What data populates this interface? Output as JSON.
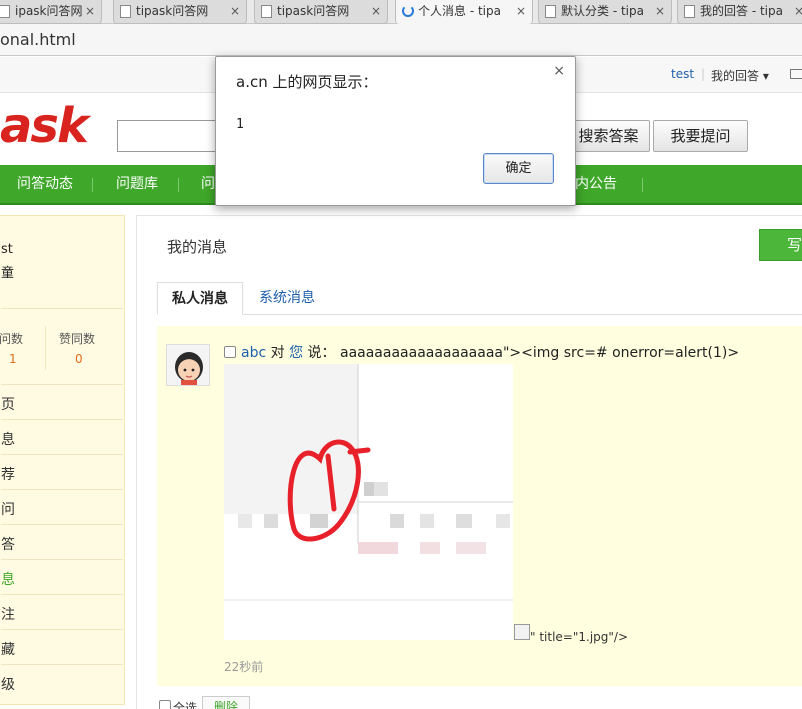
{
  "browser": {
    "tabs": [
      {
        "label": "ipask问答网",
        "close": "×"
      },
      {
        "label": "tipask问答网",
        "close": "×"
      },
      {
        "label": "tipask问答网",
        "close": "×"
      },
      {
        "label": "个人消息 - tipa",
        "close": "×"
      },
      {
        "label": "默认分类 - tipa",
        "close": "×"
      },
      {
        "label": "我的回答 - tipa",
        "close": "×"
      }
    ],
    "address": "onal.html"
  },
  "topbar": {
    "user": "test",
    "separator": "|",
    "my_answers": "我的回答 ▾"
  },
  "header": {
    "logo": "ask",
    "search_answers_button": "搜索答案",
    "ask_question_button": "我要提问"
  },
  "nav": {
    "items": [
      "问答动态",
      "问题库",
      "问",
      "站内公告"
    ]
  },
  "sidebar": {
    "name": "st",
    "subtitle": "童",
    "stats": [
      {
        "label": "提问数",
        "value": "1"
      },
      {
        "label": "赞同数",
        "value": "0"
      }
    ],
    "menu": [
      "页",
      "息",
      "荐",
      "问",
      "答",
      "息",
      "注",
      "藏",
      "级"
    ],
    "active_index": 5
  },
  "main": {
    "title": "我的消息",
    "write_button": "写",
    "tabs": [
      {
        "label": "私人消息",
        "active": true
      },
      {
        "label": "系统消息",
        "active": false
      }
    ],
    "message": {
      "sender": "abc",
      "to": "对",
      "you": "您",
      "says": "说：",
      "content": "aaaaaaaaaaaaaaaaaaa\"><img src=# onerror=alert(1)>",
      "trailing_text": "\" title=\"1.jpg\"/>",
      "time": "22秒前"
    },
    "select_all_label": "全选",
    "delete_button": "删除"
  },
  "dialog": {
    "title": "a.cn 上的网页显示：",
    "close": "×",
    "message": "1",
    "ok_button": "确定"
  },
  "colors": {
    "nav_green": "#3fa72a",
    "logo_red": "#d8231e",
    "link_blue": "#1e5fad",
    "sidebar_bg": "#fffbe3",
    "message_bg": "#ffffdf"
  }
}
